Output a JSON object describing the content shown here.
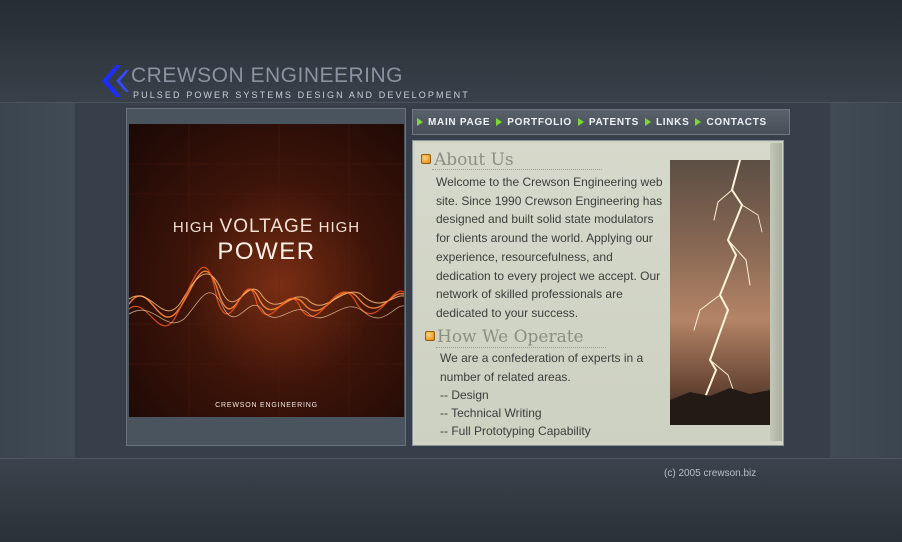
{
  "header": {
    "title": "CREWSON ENGINEERING",
    "tagline": "PULSED POWER SYSTEMS DESIGN AND DEVELOPMENT",
    "logo_icon": "double-chevron-left-icon",
    "logo_color": "#1e2cff"
  },
  "hero": {
    "line1_a": "HIGH",
    "line1_b": "VOLTAGE",
    "line1_c": "HIGH",
    "line2": "POWER",
    "caption": "CREWSON ENGINEERING"
  },
  "nav": {
    "items": [
      {
        "label": "MAIN PAGE"
      },
      {
        "label": "PORTFOLIO"
      },
      {
        "label": "PATENTS"
      },
      {
        "label": "LINKS"
      },
      {
        "label": "CONTACTS"
      }
    ],
    "arrow_color": "#7fd63a"
  },
  "about": {
    "title": "About Us",
    "body": "Welcome to the Crewson Engineering web site. Since 1990 Crewson Engineering has designed and built solid state modulators for clients around the world. Applying our experience, resourcefulness, and dedication to every project we accept. Our network of skilled professionals are dedicated to your success."
  },
  "operate": {
    "title": "How We Operate",
    "intro": "We are a confederation of experts in a number of related areas.",
    "items": [
      "-- Design",
      "-- Technical Writing",
      "-- Full Prototyping Capability"
    ]
  },
  "footer": {
    "copyright": "(c) 2005 crewson.biz"
  }
}
